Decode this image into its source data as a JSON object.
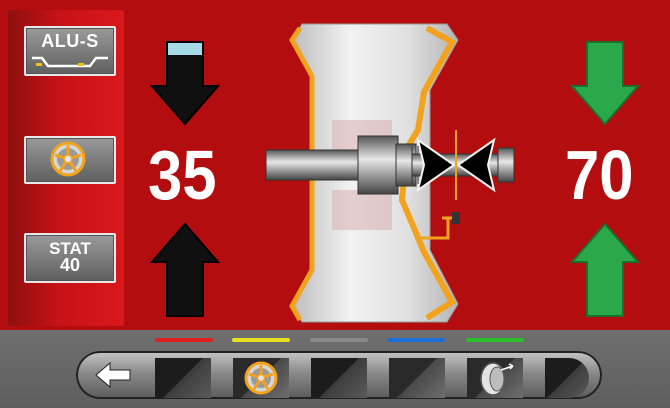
{
  "sidebar": {
    "alu_mode_label": "ALU-S",
    "stat_label_line1": "STAT",
    "stat_label_line2": "40"
  },
  "readout": {
    "left_value": "35",
    "right_value": "70"
  },
  "function_keys": {
    "led_colors": [
      "#e02020",
      "#e8e020",
      "#8a8a8a",
      "#1f6fd8",
      "#2bbf2b"
    ],
    "icons": [
      "back-arrow-icon",
      "",
      "wheel-rim-icon",
      "",
      "",
      "tire-side-icon",
      ""
    ]
  },
  "colors": {
    "background_red": "#b30d0f",
    "arrow_green": "#2aa84a",
    "arrow_black": "#101010",
    "plane_marker": "#f2a21c"
  }
}
